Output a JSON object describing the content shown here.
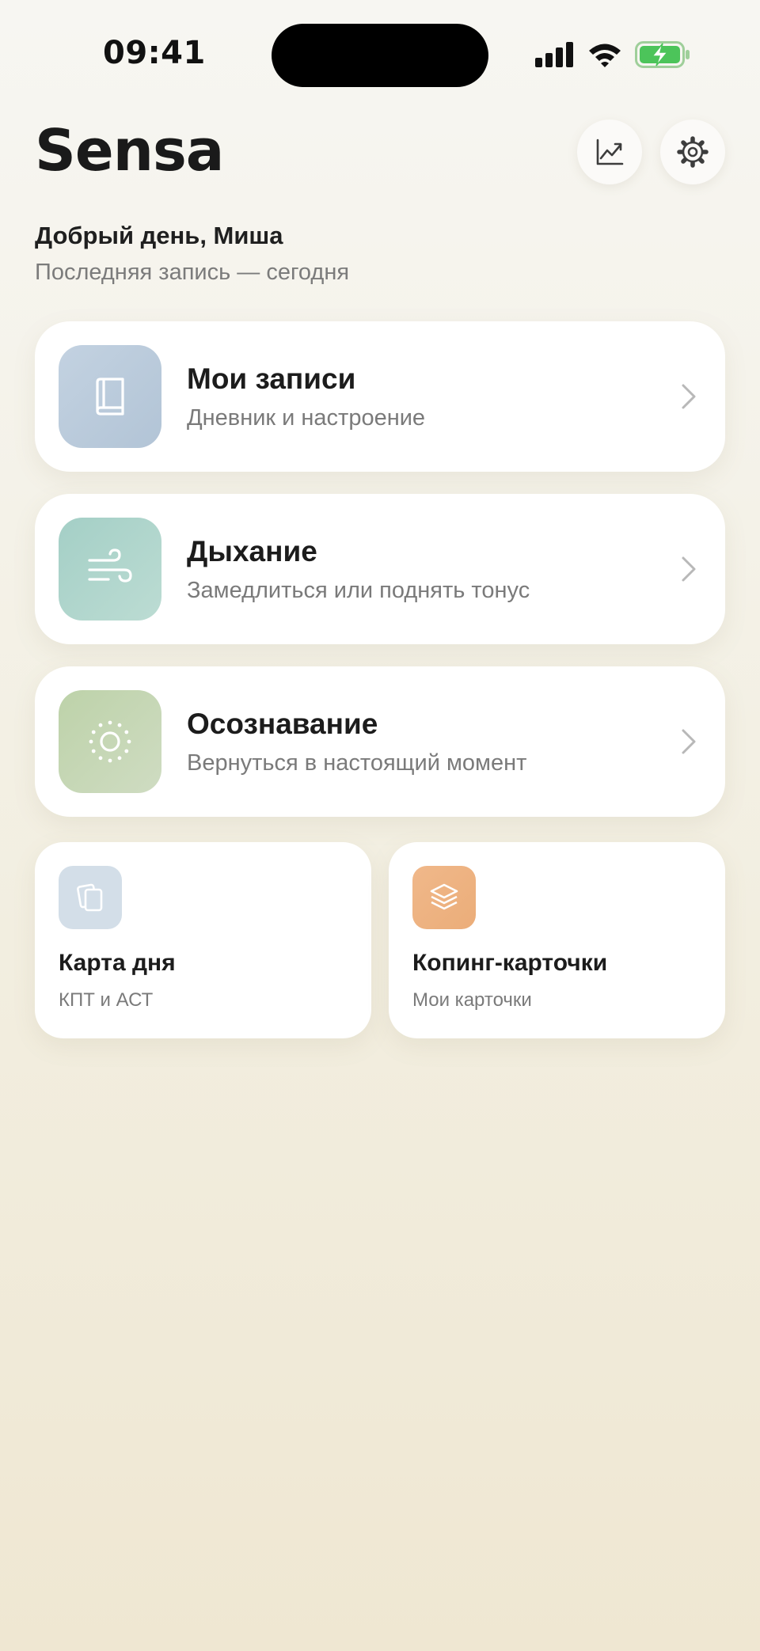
{
  "status_bar": {
    "time": "09:41"
  },
  "header": {
    "app_title": "Sensa",
    "stats_icon": "chart-line-icon",
    "settings_icon": "gear-icon"
  },
  "greeting": {
    "title": "Добрый день, Миша",
    "subtitle": "Последняя запись — сегодня"
  },
  "main_cards": [
    {
      "title": "Мои записи",
      "subtitle": "Дневник и настроение",
      "icon": "book-icon",
      "color": "#b9cadb"
    },
    {
      "title": "Дыхание",
      "subtitle": "Замедлиться или поднять тонус",
      "icon": "wind-icon",
      "color": "#aed4cc"
    },
    {
      "title": "Осознавание",
      "subtitle": "Вернуться в настоящий момент",
      "icon": "focus-sun-icon",
      "color": "#c3d5b2"
    }
  ],
  "tiles": [
    {
      "title": "Карта дня",
      "subtitle": "КПТ и АСТ",
      "icon": "cards-icon",
      "color": "#d3dee8"
    },
    {
      "title": "Копинг-карточки",
      "subtitle": "Мои карточки",
      "icon": "layers-icon",
      "color": "#eeb383"
    }
  ]
}
